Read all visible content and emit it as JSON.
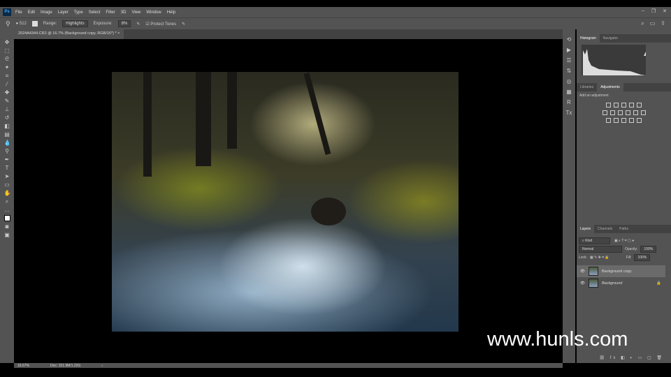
{
  "app": {
    "logo": "Ps",
    "menu": [
      "File",
      "Edit",
      "Image",
      "Layer",
      "Type",
      "Select",
      "Filter",
      "3D",
      "View",
      "Window",
      "Help"
    ]
  },
  "options": {
    "brush_size": "512",
    "range_label": "Range:",
    "range_value": "Highlights",
    "exposure_label": "Exposure:",
    "exposure_value": "8%",
    "protect_tones": "Protect Tones"
  },
  "document": {
    "tab_title": "2024A4344.CR2 @ 16.7% (Background copy, RGB/16*) *",
    "zoom": "16.67%",
    "doc_info": "Doc: 151.9M/1.22G"
  },
  "panels": {
    "histogram_tab": "Histogram",
    "navigator_tab": "Navigator",
    "libraries_tab": "Libraries",
    "adjustments_tab": "Adjustments",
    "add_adjustment": "Add an adjustment",
    "layers_tab": "Layers",
    "channels_tab": "Channels",
    "paths_tab": "Paths",
    "kind": "Kind",
    "blend_mode": "Normal",
    "opacity_label": "Opacity:",
    "opacity": "100%",
    "lock_label": "Lock:",
    "fill_label": "Fill:",
    "fill": "100%",
    "layers": [
      {
        "name": "Background copy"
      },
      {
        "name": "Background"
      }
    ]
  },
  "watermark": "www.hunls.com"
}
